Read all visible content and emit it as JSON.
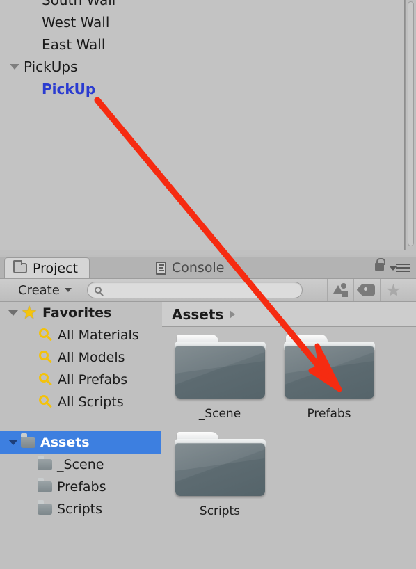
{
  "hierarchy": {
    "rows": [
      {
        "label": "South Wall",
        "indent": "child",
        "foldout": false,
        "highlight": false,
        "clipped": true
      },
      {
        "label": "West Wall",
        "indent": "child",
        "foldout": false,
        "highlight": false
      },
      {
        "label": "East Wall",
        "indent": "child",
        "foldout": false,
        "highlight": false
      },
      {
        "label": "PickUps",
        "indent": "group",
        "foldout": true,
        "highlight": false
      },
      {
        "label": "PickUp",
        "indent": "child",
        "foldout": false,
        "highlight": true
      }
    ]
  },
  "project": {
    "tabs": [
      {
        "label": "Project",
        "icon": "folder-icon",
        "active": true
      },
      {
        "label": "Console",
        "icon": "console-icon",
        "active": false
      }
    ],
    "window_controls": {
      "lock": "lock-icon",
      "menu": "hamburger-menu-icon"
    },
    "toolbar": {
      "create_label": "Create",
      "search_placeholder": "",
      "search_value": "",
      "filter_buttons": [
        {
          "name": "type-filter-icon"
        },
        {
          "name": "label-filter-icon"
        },
        {
          "name": "favorite-filter-icon"
        }
      ]
    },
    "tree": {
      "favorites": {
        "label": "Favorites",
        "expanded": true,
        "items": [
          {
            "label": "All Materials"
          },
          {
            "label": "All Models"
          },
          {
            "label": "All Prefabs"
          },
          {
            "label": "All Scripts"
          }
        ]
      },
      "assets": {
        "label": "Assets",
        "expanded": true,
        "selected": true,
        "items": [
          {
            "label": "_Scene"
          },
          {
            "label": "Prefabs"
          },
          {
            "label": "Scripts"
          }
        ]
      }
    },
    "breadcrumb": {
      "path": "Assets",
      "separator": "chevron-right-icon"
    },
    "grid_items": [
      {
        "label": "_Scene",
        "icon": "folder-icon"
      },
      {
        "label": "Prefabs",
        "icon": "folder-icon"
      },
      {
        "label": "Scripts",
        "icon": "folder-icon",
        "label_clipped": true
      }
    ]
  },
  "annotation": {
    "arrow_color": "#f62b11",
    "from": "PickUp (hierarchy)",
    "to": "Prefabs (project folder)"
  },
  "colors": {
    "panel_bg": "#c0c0c0",
    "toolbar_bg": "#cdcdcd",
    "selection_blue": "#3d7fe0",
    "link_blue": "#2a3bd0",
    "favorite_yellow": "#f3c20c",
    "folder_slate": "#67747a",
    "arrow_red": "#f62b11"
  }
}
